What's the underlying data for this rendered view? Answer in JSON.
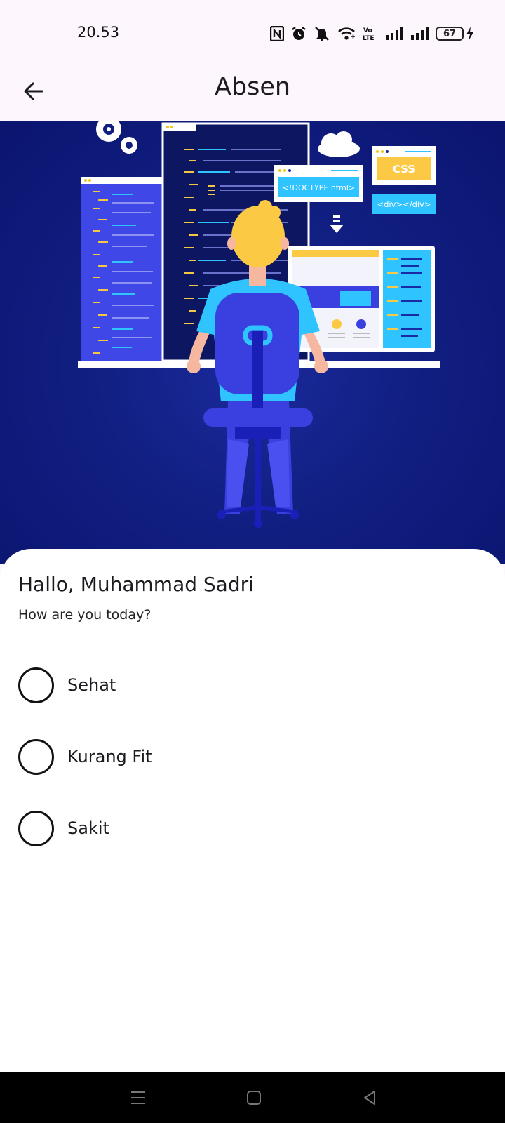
{
  "status_bar": {
    "time": "20.53",
    "battery_level": "67",
    "icons": [
      "nfc-icon",
      "alarm-icon",
      "mute-icon",
      "wifi-icon",
      "volte-icon",
      "signal-icon",
      "signal-icon",
      "battery-icon",
      "charging-icon"
    ]
  },
  "app_bar": {
    "title": "Absen",
    "back_icon": "arrow-left-icon"
  },
  "hero": {
    "doctype_label": "<!DOCTYPE html>",
    "css_label": "CSS",
    "div_label": "<div></div>"
  },
  "card": {
    "greeting": "Hallo, Muhammad Sadri",
    "subtitle": "How are you today?",
    "options": [
      {
        "label": "Sehat",
        "selected": false
      },
      {
        "label": "Kurang Fit",
        "selected": false
      },
      {
        "label": "Sakit",
        "selected": false
      }
    ]
  },
  "nav_bar": {
    "icons": [
      "menu-icon",
      "home-icon",
      "back-triangle-icon"
    ]
  },
  "colors": {
    "app_bar_bg": "#fdf7fd",
    "hero_bg": "#111f82",
    "card_bg": "#ffffff",
    "nav_bg": "#000000"
  }
}
